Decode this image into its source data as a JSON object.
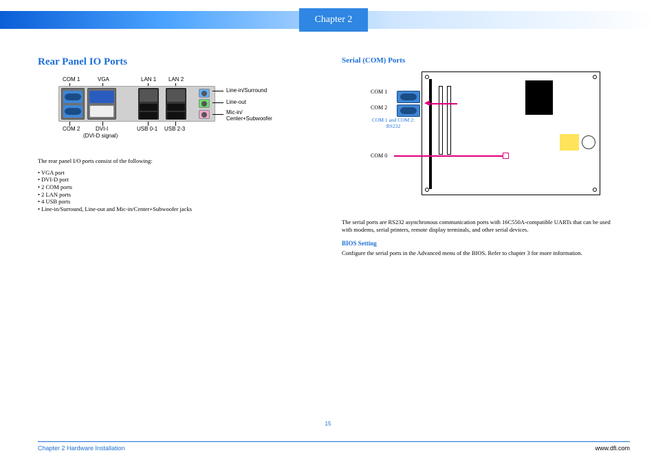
{
  "header": {
    "chapter": "Chapter 2"
  },
  "left": {
    "title": "Rear Panel IO Ports",
    "diagram": {
      "top": {
        "com1": "COM 1",
        "vga": "VGA",
        "lan1": "LAN 1",
        "lan2": "LAN 2"
      },
      "bottom": {
        "com2": "COM 2",
        "dvi": "DVI-I",
        "dvi_sub": "(DVI-D signal)",
        "usb01": "USB 0-1",
        "usb23": "USB 2-3"
      },
      "jacks": {
        "line_in": "Line-in/Surround",
        "line_out": "Line-out",
        "mic": "Mic-in/\nCenter+Subwoofer"
      }
    },
    "intro": "The rear panel I/O ports consist of the following:",
    "bullets": [
      "VGA port",
      "DVI-D port",
      "2 COM ports",
      "2 LAN ports",
      "4 USB ports",
      "Line-in/Surround, Line-out and Mic-in/Center+Subwoofer jacks"
    ]
  },
  "right": {
    "title": "Serial (COM) Ports",
    "labels": {
      "com1": "COM 1",
      "com2": "COM 2",
      "com0": "COM 0",
      "note": "COM 1 and COM 2:\nRS232"
    },
    "para": "The serial ports are RS232 asynchronous communication ports with 16C550A-compatible UARTs that can be used with modems, serial printers, remote display terminals, and other serial devices.",
    "bios_heading": "BIOS Setting",
    "bios_text": "Configure the serial ports in the Advanced menu of the BIOS. Refer to chapter 3 for more information."
  },
  "footer": {
    "page": "15",
    "left": "Chapter 2 Hardware Installation",
    "right": "www.dfi.com"
  }
}
